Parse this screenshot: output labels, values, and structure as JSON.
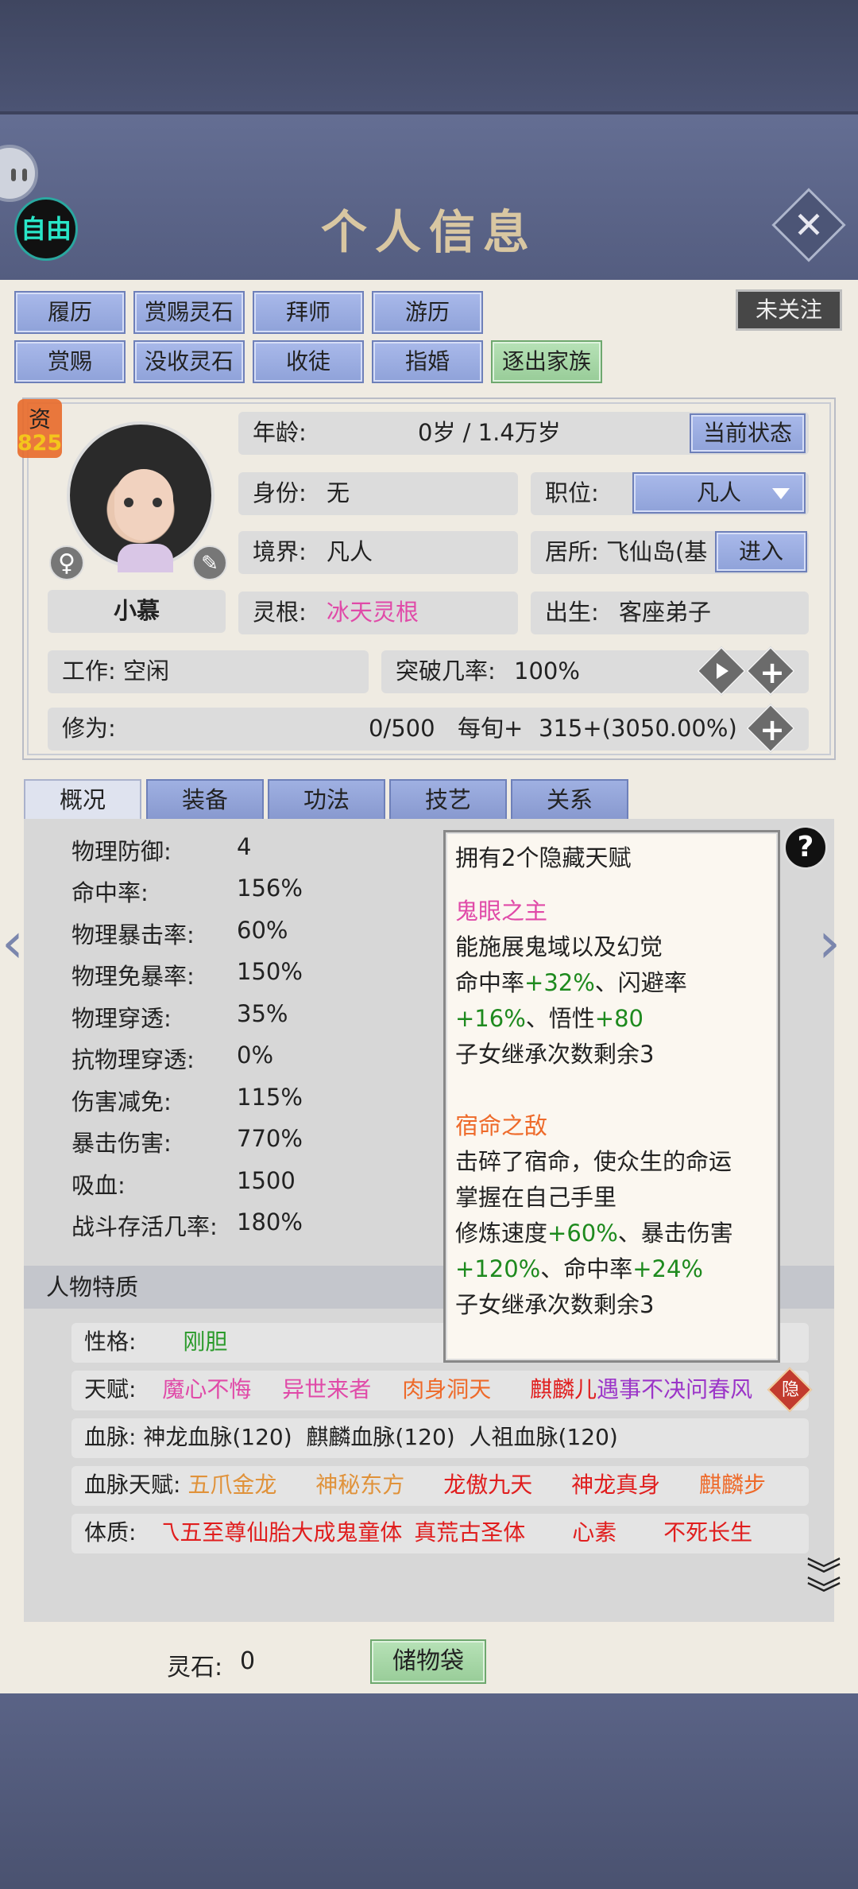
{
  "header": {
    "title": "个人信息",
    "free_badge": "自由",
    "close_label": "✕"
  },
  "follow_button": "未关注",
  "action_buttons_row1": [
    "履历",
    "赏赐灵石",
    "拜师",
    "游历"
  ],
  "action_buttons_row2": [
    "赏赐",
    "没收灵石",
    "收徒",
    "指婚",
    "逐出家族"
  ],
  "profile": {
    "zi_label": "资",
    "zi_value": "825",
    "name": "小慕",
    "age_label": "年龄:",
    "age_value": "0岁 / 1.4万岁",
    "status_button": "当前状态",
    "identity_label": "身份:",
    "identity_value": "无",
    "position_label": "职位:",
    "position_value": "凡人",
    "realm_label": "境界:",
    "realm_value": "凡人",
    "residence_label": "居所:",
    "residence_value": "飞仙岛(基",
    "enter_button": "进入",
    "root_label": "灵根:",
    "root_value": "冰天灵根",
    "birth_label": "出生:",
    "birth_value": "客座弟子",
    "work_label": "工作:",
    "work_value": "空闲",
    "breakthrough_label": "突破几率:",
    "breakthrough_value": "100%",
    "cultivation_label": "修为:",
    "cultivation_value": "0/500",
    "per_round_label": "每旬+",
    "per_round_value": "315+(3050.00%)"
  },
  "tabs": [
    "概况",
    "装备",
    "功法",
    "技艺",
    "关系"
  ],
  "stats": [
    {
      "label": "物理防御:",
      "value": "4"
    },
    {
      "label": "命中率:",
      "value": "156%"
    },
    {
      "label": "物理暴击率:",
      "value": "60%"
    },
    {
      "label": "物理免暴率:",
      "value": "150%"
    },
    {
      "label": "物理穿透:",
      "value": "35%"
    },
    {
      "label": "抗物理穿透:",
      "value": "0%"
    },
    {
      "label": "伤害减免:",
      "value": "115%"
    },
    {
      "label": "暴击伤害:",
      "value": "770%"
    },
    {
      "label": "吸血:",
      "value": "1500"
    },
    {
      "label": "战斗存活几率:",
      "value": "180%"
    }
  ],
  "popup": {
    "header": "拥有2个隐藏天赋",
    "t1_name": "鬼眼之主",
    "t1_l1": "能施展鬼域以及幻觉",
    "t1_l2a": "命中率",
    "t1_l2b": "+32%",
    "t1_l2c": "、闪避率",
    "t1_l3a": "+16%",
    "t1_l3b": "、悟性",
    "t1_l3c": "+80",
    "t1_l4": "子女继承次数剩余3",
    "t2_name": "宿命之敌",
    "t2_l1": "击碎了宿命，使众生的命运",
    "t2_l2": "掌握在自己手里",
    "t2_l3a": "修炼速度",
    "t2_l3b": "+60%",
    "t2_l3c": "、暴击伤害",
    "t2_l4a": "+120%",
    "t2_l4b": "、命中率",
    "t2_l4c": "+24%",
    "t2_l5": "子女继承次数剩余3"
  },
  "traits": {
    "section_title": "人物特质",
    "personality_label": "性格:",
    "personality_value": "刚胆",
    "talent_label": "天赋:",
    "talents": [
      "魔心不悔",
      "异世来者",
      "肉身洞天",
      "麒麟儿",
      "遇事不决问春风"
    ],
    "hidden_badge": "隐",
    "bloodline_label": "血脉:",
    "bloodlines": "神龙血脉(120)  麒麟血脉(120)  人祖血脉(120)",
    "bloodline_talent_label": "血脉天赋:",
    "bloodline_talents": [
      "五爪金龙",
      "神秘东方",
      "龙傲九天",
      "神龙真身",
      "麒麟步"
    ],
    "physique_label": "体质:",
    "physiques": [
      "乁五至尊仙胎大成鬼童体",
      "真荒古圣体",
      "心素",
      "不死长生"
    ]
  },
  "footer": {
    "spirit_stone_label": "灵石:",
    "spirit_stone_value": "0",
    "bag_button": "储物袋"
  },
  "colors": {
    "blue_button": "#9fb0e2",
    "green_button": "#a8d8a8",
    "header_bg": "#5b6488",
    "panel_bg": "#efebe2"
  }
}
